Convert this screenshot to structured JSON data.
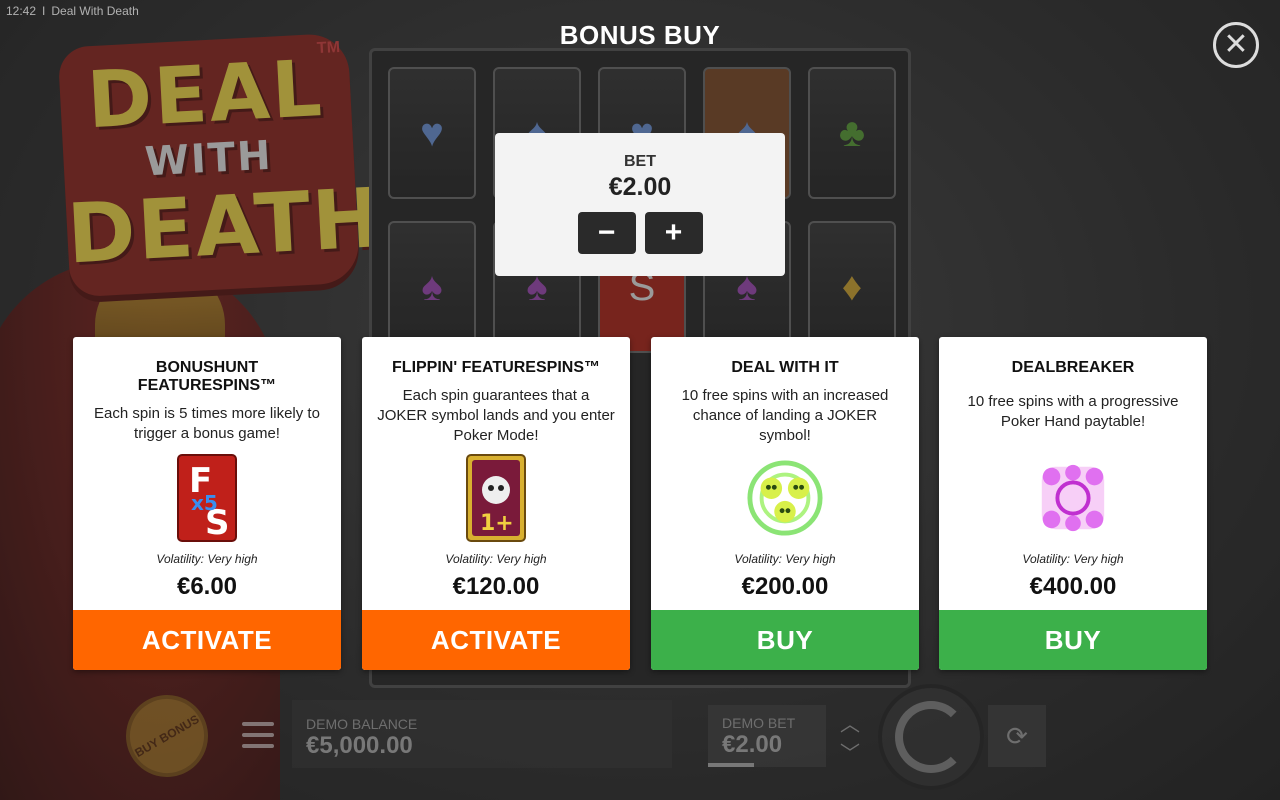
{
  "status_bar": {
    "time": "12:42",
    "separator": "I",
    "app_title": "Deal With Death"
  },
  "logo": {
    "line1": "DEAL",
    "line2": "WITH",
    "line3": "DEATH",
    "tm": "TM"
  },
  "modal": {
    "title": "BONUS BUY",
    "close_icon": "close-icon",
    "bet": {
      "label": "BET",
      "value": "€2.00",
      "minus_label": "−",
      "plus_label": "+"
    }
  },
  "cards": [
    {
      "title": "BONUSHUNT FEATURESPINS™",
      "description": "Each spin is 5 times more likely to trigger a bonus game!",
      "art_icon": "fs-x5-card-icon",
      "volatility": "Volatility: Very high",
      "price": "€6.00",
      "button_label": "ACTIVATE",
      "button_color": "#ff6600"
    },
    {
      "title": "FLIPPIN' FEATURESPINS™",
      "description": "Each spin guarantees that a JOKER symbol lands and you enter Poker Mode!",
      "art_icon": "joker-card-icon",
      "volatility": "Volatility: Very high",
      "price": "€120.00",
      "button_label": "ACTIVATE",
      "button_color": "#ff6600"
    },
    {
      "title": "DEAL WITH IT",
      "description": "10 free spins with an increased chance of landing a JOKER symbol!",
      "art_icon": "green-skulls-icon",
      "volatility": "Volatility: Very high",
      "price": "€200.00",
      "button_label": "BUY",
      "button_color": "#3cb04a"
    },
    {
      "title": "DEALBREAKER",
      "description": "10 free spins with a progressive Poker Hand paytable!",
      "art_icon": "pink-skulls-icon",
      "volatility": "Volatility: Very high",
      "price": "€400.00",
      "button_label": "BUY",
      "button_color": "#3cb04a"
    }
  ],
  "bottom_bar": {
    "buy_bonus_label": "BUY BONUS",
    "menu_icon": "hamburger-menu-icon",
    "balance_label": "DEMO BALANCE",
    "balance_value": "€5,000.00",
    "bet_label": "DEMO BET",
    "bet_value": "€2.00",
    "bet_up_icon": "chevron-up-icon",
    "bet_down_icon": "chevron-down-icon",
    "spin_icon": "spin-icon",
    "autoplay_icon": "autoplay-icon"
  },
  "colors": {
    "activate": "#ff6600",
    "buy": "#3cb04a",
    "reel_suit": "#6a8fd0"
  },
  "reel_symbols": [
    "♥",
    "♠",
    "♥",
    "♠",
    "♣",
    "♠",
    "♠",
    "S",
    "♠",
    "♦"
  ]
}
